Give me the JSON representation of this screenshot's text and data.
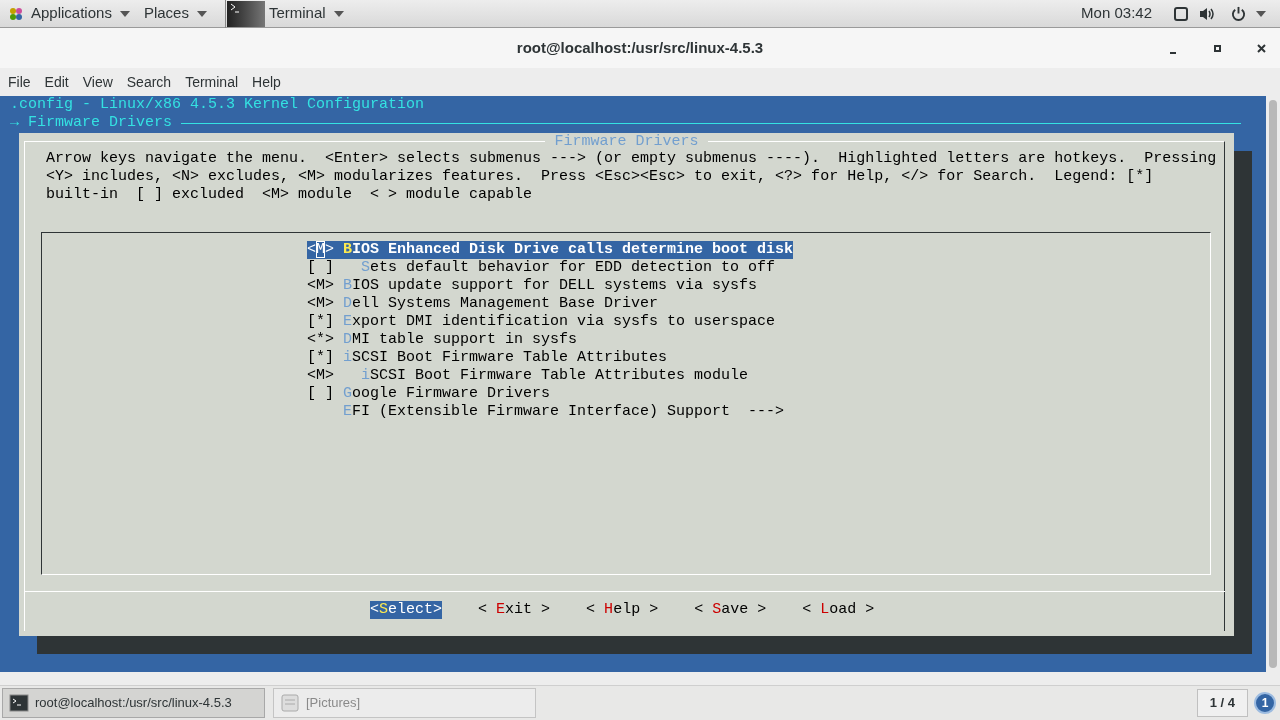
{
  "top_bar": {
    "applications": "Applications",
    "places": "Places",
    "task": "Terminal",
    "clock": "Mon 03:42"
  },
  "window": {
    "title": "root@localhost:/usr/src/linux-4.5.3",
    "menu": [
      "File",
      "Edit",
      "View",
      "Search",
      "Terminal",
      "Help"
    ]
  },
  "terminal": {
    "header": ".config - Linux/x86 4.5.3 Kernel Configuration",
    "breadcrumb": "→ Firmware Drivers",
    "dialog": {
      "title": "Firmware Drivers",
      "help_lines": [
        "Arrow keys navigate the menu.  <Enter> selects submenus ---> (or empty submenus ----).  Highlighted letters are hotkeys.  Pressing",
        "<Y> includes, <N> excludes, <M> modularizes features.  Press <Esc><Esc> to exit, <?> for Help, </> for Search.  Legend: [*]",
        "built-in  [ ] excluded  <M> module  < > module capable"
      ],
      "items": [
        {
          "state": "<M>",
          "label": "BIOS Enhanced Disk Drive calls determine boot disk",
          "selected": true,
          "children": [
            {
              "state": "[ ]",
              "label": "Sets default behavior for EDD detection to off",
              "selected": false
            }
          ]
        },
        {
          "state": "<M>",
          "label": "BIOS update support for DELL systems via sysfs",
          "selected": false
        },
        {
          "state": "<M>",
          "label": "Dell Systems Management Base Driver",
          "selected": false
        },
        {
          "state": "[*]",
          "label": "Export DMI identification via sysfs to userspace",
          "selected": false
        },
        {
          "state": "<*>",
          "label": "DMI table support in sysfs",
          "selected": false
        },
        {
          "state": "[*]",
          "label": "iSCSI Boot Firmware Table Attributes",
          "selected": false,
          "children": [
            {
              "state": "<M>",
              "label": "iSCSI Boot Firmware Table Attributes module",
              "selected": false
            }
          ]
        },
        {
          "state": "[ ]",
          "label": "Google Firmware Drivers",
          "selected": false
        },
        {
          "label": "EFI (Extensible Firmware Interface) Support",
          "submenu": "--->",
          "selected": false
        }
      ],
      "buttons": [
        {
          "label": "<Select>",
          "selected": true
        },
        {
          "label": "< Exit >",
          "selected": false
        },
        {
          "label": "< Help >",
          "selected": false
        },
        {
          "label": "< Save >",
          "selected": false
        },
        {
          "label": "< Load >",
          "selected": false
        }
      ]
    }
  },
  "taskbar": {
    "items": [
      {
        "label": "root@localhost:/usr/src/linux-4.5.3",
        "selected": true
      },
      {
        "label": "[Pictures]",
        "selected": false
      }
    ],
    "workspace": "1 / 4",
    "badge": "1"
  }
}
